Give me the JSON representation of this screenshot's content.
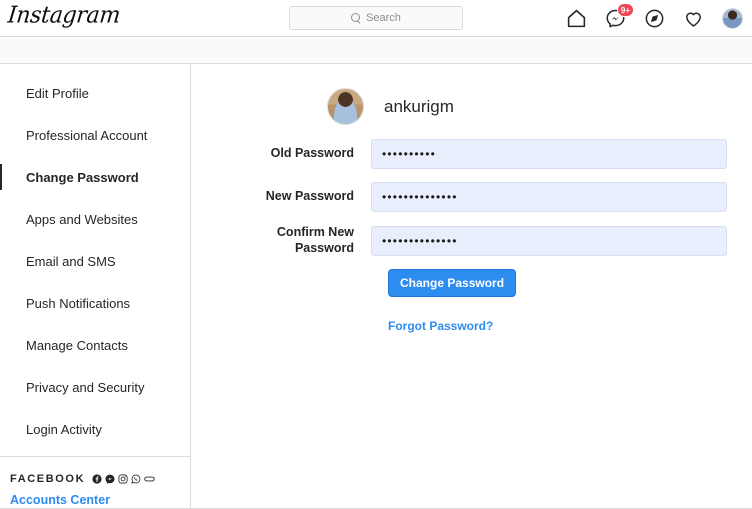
{
  "header": {
    "logo": "Instagram",
    "search": {
      "placeholder": "Search",
      "value": "",
      "icon": "search-icon"
    },
    "icons": [
      {
        "name": "home-icon",
        "badge": null
      },
      {
        "name": "messenger-icon",
        "badge": "9+"
      },
      {
        "name": "explore-compass-icon",
        "badge": null
      },
      {
        "name": "heart-activity-icon",
        "badge": null
      },
      {
        "name": "profile-avatar",
        "badge": null
      }
    ],
    "badge_color": "#ed4956"
  },
  "sidebar": {
    "items": [
      {
        "label": "Edit Profile",
        "active": false
      },
      {
        "label": "Professional Account",
        "active": false
      },
      {
        "label": "Change Password",
        "active": true
      },
      {
        "label": "Apps and Websites",
        "active": false
      },
      {
        "label": "Email and SMS",
        "active": false
      },
      {
        "label": "Push Notifications",
        "active": false
      },
      {
        "label": "Manage Contacts",
        "active": false
      },
      {
        "label": "Privacy and Security",
        "active": false
      },
      {
        "label": "Login Activity",
        "active": false
      }
    ],
    "facebook_section": {
      "title": "FACEBOOK",
      "icons": [
        "facebook-icon",
        "messenger-icon",
        "instagram-icon",
        "whatsapp-icon",
        "portal-icon"
      ],
      "accounts_center_label": "Accounts Center",
      "link_color": "#2d8cf0"
    }
  },
  "main": {
    "username": "ankurigm",
    "avatar": "user-avatar",
    "fields": [
      {
        "label": "Old Password",
        "value": "••••••••••",
        "masked": true
      },
      {
        "label": "New Password",
        "value": "••••••••••••••",
        "masked": true
      },
      {
        "label": "Confirm New Password",
        "value": "••••••••••••••",
        "masked": true
      }
    ],
    "submit_label": "Change Password",
    "forgot_label": "Forgot Password?",
    "button_color": "#2d8cf0",
    "input_background": "#e8eefb"
  }
}
